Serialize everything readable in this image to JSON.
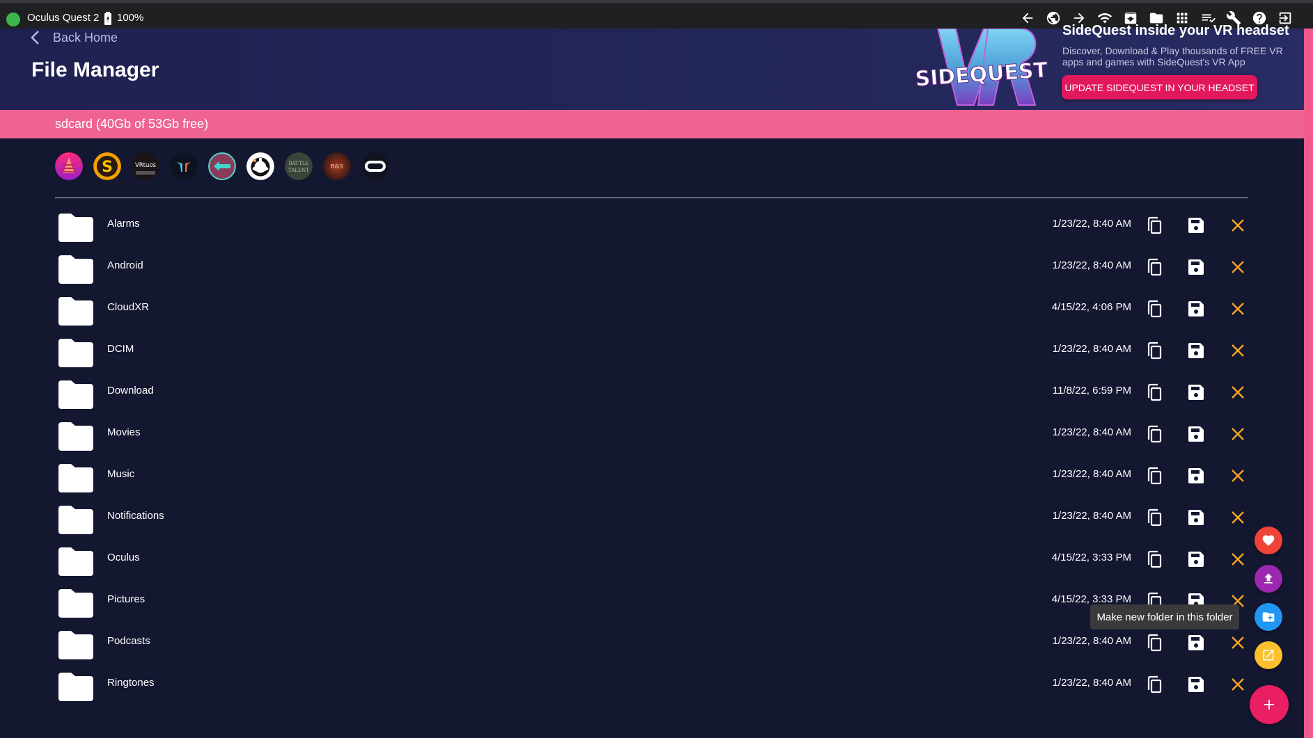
{
  "status_bar": {
    "device_name": "Oculus Quest 2",
    "battery": "100%",
    "connection_color": "#3cb54a",
    "toolbar_icons": [
      "back-arrow-icon",
      "globe-icon",
      "forward-arrow-icon",
      "wifi-icon",
      "install-box-icon",
      "folder-icon",
      "apps-grid-icon",
      "task-list-icon",
      "wrench-icon",
      "help-icon",
      "exit-icon"
    ]
  },
  "header": {
    "back_label": "Back Home",
    "title": "File Manager",
    "promo": {
      "logo_text": "SIDEQUEST",
      "heading": "SideQuest inside your VR headset",
      "text": "Discover, Download & Play thousands of FREE VR apps and games with SideQuest's VR App",
      "button_label": "UPDATE SIDEQUEST IN YOUR HEADSET"
    }
  },
  "storage": {
    "label": "sdcard (40Gb of 53Gb free)"
  },
  "shortcuts": [
    {
      "name": "app-shortcut-1",
      "label": ""
    },
    {
      "name": "app-shortcut-sidequest",
      "label": "S"
    },
    {
      "name": "app-shortcut-vrtuos",
      "label": "VRtuos"
    },
    {
      "name": "app-shortcut-4",
      "label": ""
    },
    {
      "name": "app-shortcut-5",
      "label": ""
    },
    {
      "name": "app-shortcut-6",
      "label": ""
    },
    {
      "name": "app-shortcut-battle-talent",
      "label": "BATTLE TALENT"
    },
    {
      "name": "app-shortcut-bs",
      "label": "B&S"
    },
    {
      "name": "app-shortcut-oculus",
      "label": ""
    }
  ],
  "folders": [
    {
      "name": "Alarms",
      "date": "1/23/22, 8:40 AM"
    },
    {
      "name": "Android",
      "date": "1/23/22, 8:40 AM"
    },
    {
      "name": "CloudXR",
      "date": "4/15/22, 4:06 PM"
    },
    {
      "name": "DCIM",
      "date": "1/23/22, 8:40 AM"
    },
    {
      "name": "Download",
      "date": "11/8/22, 6:59 PM"
    },
    {
      "name": "Movies",
      "date": "1/23/22, 8:40 AM"
    },
    {
      "name": "Music",
      "date": "1/23/22, 8:40 AM"
    },
    {
      "name": "Notifications",
      "date": "1/23/22, 8:40 AM"
    },
    {
      "name": "Oculus",
      "date": "4/15/22, 3:33 PM"
    },
    {
      "name": "Pictures",
      "date": "4/15/22, 3:33 PM"
    },
    {
      "name": "Podcasts",
      "date": "1/23/22, 8:40 AM"
    },
    {
      "name": "Ringtones",
      "date": "1/23/22, 8:40 AM"
    }
  ],
  "tooltip": "Make new folder in this folder",
  "colors": {
    "accent_pink": "#ee6394",
    "delete_orange": "#f5a623",
    "promo_button": "#e2185c"
  }
}
